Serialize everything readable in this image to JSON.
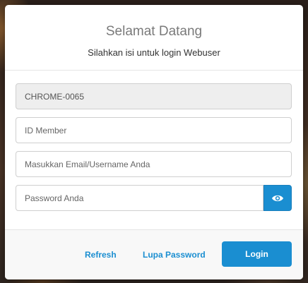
{
  "modal": {
    "title": "Selamat Datang",
    "subtitle": "Silahkan isi untuk login Webuser"
  },
  "form": {
    "computer_name": {
      "value": "CHROME-0065"
    },
    "member_id": {
      "placeholder": "ID Member",
      "value": ""
    },
    "email": {
      "placeholder": "Masukkan Email/Username Anda",
      "value": ""
    },
    "password": {
      "placeholder": "Password Anda",
      "value": ""
    },
    "toggle_icon": "eye-icon"
  },
  "footer": {
    "refresh_label": "Refresh",
    "forgot_label": "Lupa Password",
    "login_label": "Login"
  },
  "colors": {
    "accent": "#1a8ed1",
    "readonly_bg": "#eeeeee",
    "title_text": "#7a7a7a"
  }
}
